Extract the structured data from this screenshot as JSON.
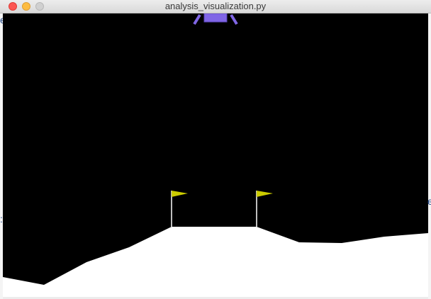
{
  "window": {
    "title": "analysis_visualization.py"
  },
  "colors": {
    "sky": "#000000",
    "terrain": "#ffffff",
    "lander_body": "#8066e6",
    "lander_legs": "#8066e6",
    "flag": "#cccc00",
    "flagpole": "#ffffff",
    "close_button": "#fc5753",
    "minimize_button": "#fdbc40",
    "zoom_button": "#d0d0d0"
  }
}
